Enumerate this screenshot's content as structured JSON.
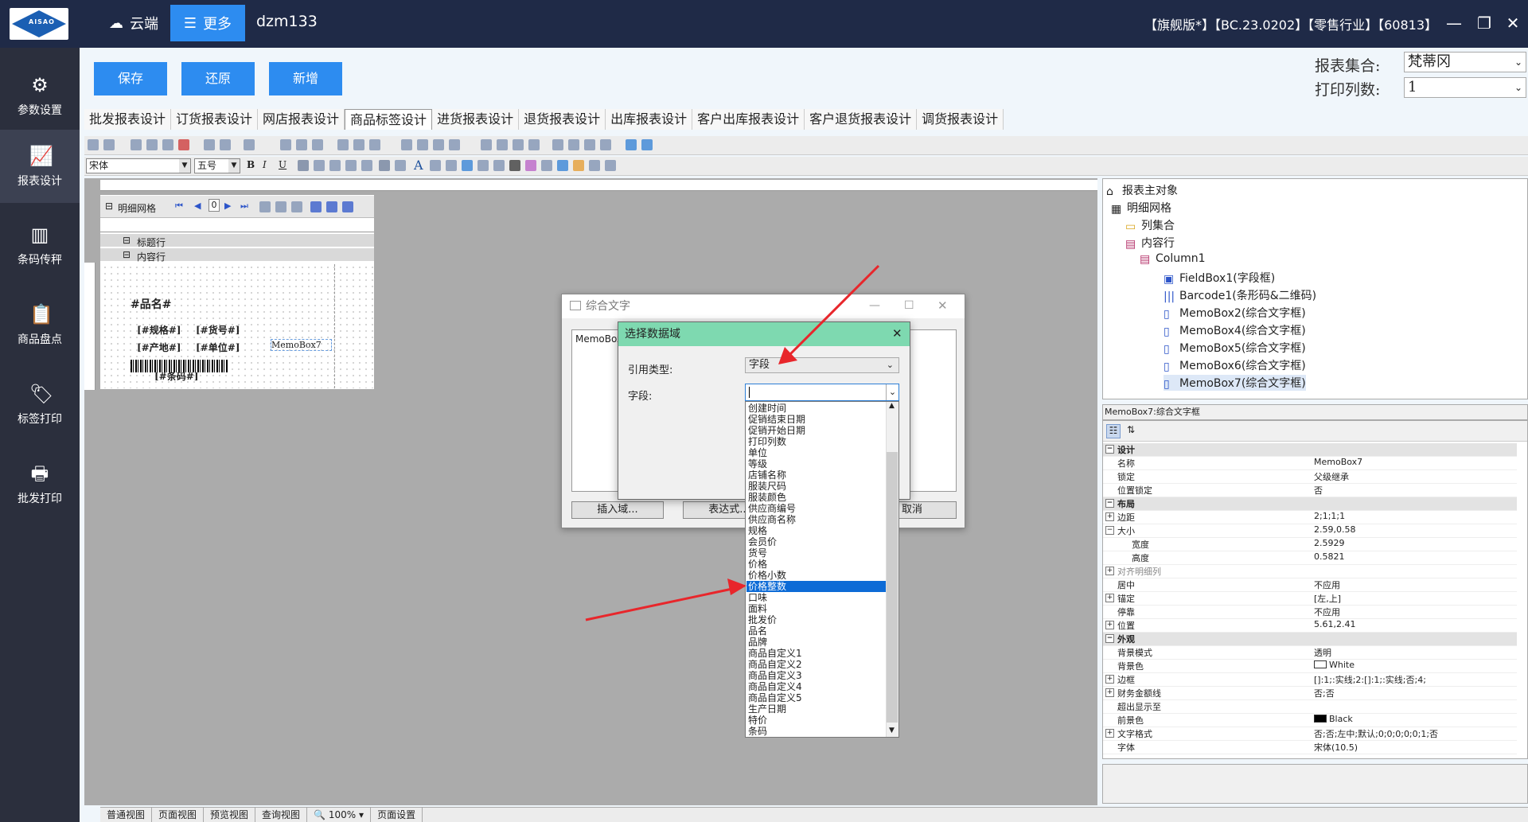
{
  "topbar": {
    "cloud_label": "云端",
    "more_label": "更多",
    "account": "dzm133",
    "version": "【旗舰版*】【BC.23.0202】【零售行业】【60813】",
    "logo_text": "AISAO"
  },
  "sidebar": {
    "items": [
      {
        "label": "参数设置"
      },
      {
        "label": "报表设计"
      },
      {
        "label": "条码传秤"
      },
      {
        "label": "商品盘点"
      },
      {
        "label": "标签打印"
      },
      {
        "label": "批发打印"
      }
    ]
  },
  "actions": {
    "save": "保存",
    "restore": "还原",
    "add": "新增"
  },
  "report_set": {
    "label": "报表集合:",
    "value": "梵蒂冈",
    "print_cols_label": "打印列数:",
    "print_cols_value": "1"
  },
  "tabs": [
    "批发报表设计",
    "订货报表设计",
    "网店报表设计",
    "商品标签设计",
    "进货报表设计",
    "退货报表设计",
    "出库报表设计",
    "客户出库报表设计",
    "客户退货报表设计",
    "调货报表设计"
  ],
  "active_tab": "商品标签设计",
  "format_bar": {
    "font": "宋体",
    "size": "五号",
    "bold": "B",
    "italic": "I",
    "underline": "U",
    "text_tool": "A"
  },
  "design": {
    "grid_title": "明细网格",
    "page_no": "0",
    "title_row": "标题行",
    "content_row": "内容行",
    "fields": {
      "name": "#品名#",
      "spec": "[#规格#]",
      "code": "[#货号#]",
      "origin": "[#产地#]",
      "unit": "[#单位#]",
      "barcode": "[#条码#]",
      "memo": "MemoBox7"
    }
  },
  "tree": {
    "root": "报表主对象",
    "items": [
      "明细网格",
      "列集合",
      "内容行",
      "Column1",
      "FieldBox1(字段框)",
      "Barcode1(条形码&二维码)",
      "MemoBox2(综合文字框)",
      "MemoBox4(综合文字框)",
      "MemoBox5(综合文字框)",
      "MemoBox6(综合文字框)",
      "MemoBox7(综合文字框)"
    ]
  },
  "properties": {
    "header": "MemoBox7:综合文字框",
    "rows": [
      {
        "type": "cat",
        "k": "设计",
        "v": ""
      },
      {
        "type": "row",
        "k": "名称",
        "v": "MemoBox7"
      },
      {
        "type": "row",
        "k": "锁定",
        "v": "父级继承"
      },
      {
        "type": "row",
        "k": "位置锁定",
        "v": "否"
      },
      {
        "type": "cat",
        "k": "布局",
        "v": ""
      },
      {
        "type": "row",
        "k": "边距",
        "v": "2;1;1;1",
        "exp": "+"
      },
      {
        "type": "row",
        "k": "大小",
        "v": "2.59,0.58",
        "exp": "-"
      },
      {
        "type": "row",
        "k": "宽度",
        "v": "2.5929",
        "indent": true
      },
      {
        "type": "row",
        "k": "高度",
        "v": "0.5821",
        "indent": true
      },
      {
        "type": "row",
        "k": "对齐明细列",
        "v": "",
        "exp": "+",
        "grey": true
      },
      {
        "type": "row",
        "k": "居中",
        "v": "不应用"
      },
      {
        "type": "row",
        "k": "锚定",
        "v": "[左,上]",
        "exp": "+"
      },
      {
        "type": "row",
        "k": "停靠",
        "v": "不应用"
      },
      {
        "type": "row",
        "k": "位置",
        "v": "5.61,2.41",
        "exp": "+"
      },
      {
        "type": "cat",
        "k": "外观",
        "v": ""
      },
      {
        "type": "row",
        "k": "背景模式",
        "v": "透明"
      },
      {
        "type": "row",
        "k": "背景色",
        "v": "White",
        "swatch": "#ffffff"
      },
      {
        "type": "row",
        "k": "边框",
        "v": "[]:1;:实线;2:[]:1;:实线;否;4;",
        "exp": "+"
      },
      {
        "type": "row",
        "k": "财务金额线",
        "v": "否;否",
        "exp": "+"
      },
      {
        "type": "row",
        "k": "超出显示至",
        "v": ""
      },
      {
        "type": "row",
        "k": "前景色",
        "v": "Black",
        "swatch": "#000000"
      },
      {
        "type": "row",
        "k": "文字格式",
        "v": "否;否;左中;默认;0;0;0;0;0;1;否",
        "exp": "+"
      },
      {
        "type": "row",
        "k": "字体",
        "v": "宋体(10.5)"
      }
    ]
  },
  "statusbar": {
    "items": [
      "普通视图",
      "页面视图",
      "预览视图",
      "查询视图",
      "100%",
      "页面设置"
    ]
  },
  "dialog_memo": {
    "title": "综合文字",
    "memo": "MemoBox",
    "insert": "插入域...",
    "expr": "表达式...",
    "cancel": "取消"
  },
  "dialog_field": {
    "title": "选择数据域",
    "ref_type_label": "引用类型:",
    "ref_type_value": "字段",
    "field_label": "字段:",
    "options": [
      "创建时间",
      "促销结束日期",
      "促销开始日期",
      "打印列数",
      "单位",
      "等级",
      "店铺名称",
      "服装尺码",
      "服装颜色",
      "供应商编号",
      "供应商名称",
      "规格",
      "会员价",
      "货号",
      "价格",
      "价格小数",
      "价格整数",
      "口味",
      "面料",
      "批发价",
      "品名",
      "品牌",
      "商品自定义1",
      "商品自定义2",
      "商品自定义3",
      "商品自定义4",
      "商品自定义5",
      "生产日期",
      "特价",
      "条码"
    ],
    "selected": "价格整数"
  },
  "colors": {
    "accent": "#2d8cf0",
    "topbar": "#1f2a47",
    "sidebar": "#2b2f3d",
    "dialog_title": "#7ed9b0",
    "arrow": "#e8262b"
  }
}
